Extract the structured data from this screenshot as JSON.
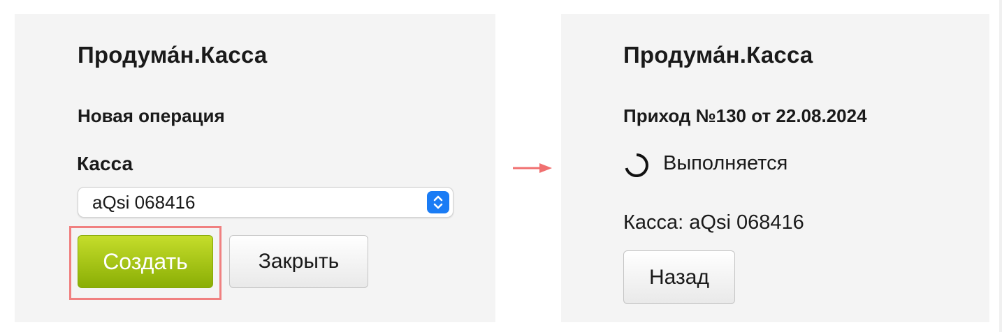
{
  "colors": {
    "panel_bg": "#f4f4f4",
    "create_button": "#9fbf10",
    "highlight": "#f08080",
    "select_accent": "#1a7cf5",
    "arrow": "#f07070"
  },
  "left_panel": {
    "app_title": "Продума́н.Касса",
    "section_title": "Новая операция",
    "register_label": "Касса",
    "register_select": {
      "value": "aQsi 068416",
      "icon": "chevron-up-down-icon"
    },
    "create_button": "Создать",
    "close_button": "Закрыть"
  },
  "transition": {
    "icon": "arrow-right-icon"
  },
  "right_panel": {
    "app_title": "Продума́н.Касса",
    "operation_title": "Приход №130 от 22.08.2024",
    "status": {
      "icon": "spinner-icon",
      "text": "Выполняется"
    },
    "register_info": "Касса: aQsi 068416",
    "back_button": "Назад"
  }
}
